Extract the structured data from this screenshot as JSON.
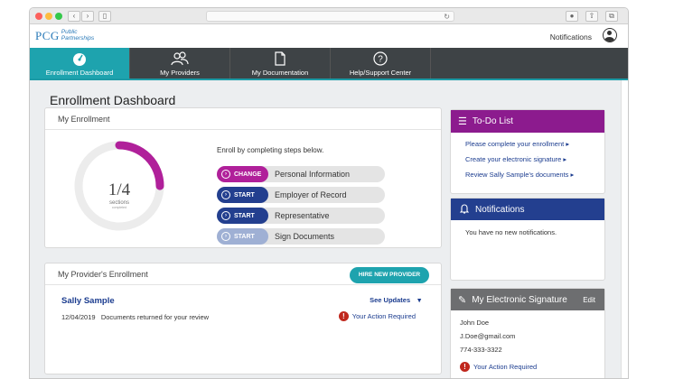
{
  "header": {
    "logo_mark": "PCG",
    "logo_line1": "Public",
    "logo_line2": "Partnerships",
    "notifications_link": "Notifications"
  },
  "nav": {
    "tabs": [
      {
        "label": "Enrollment Dashboard",
        "icon": "gauge-icon"
      },
      {
        "label": "My Providers",
        "icon": "people-icon"
      },
      {
        "label": "My Documentation",
        "icon": "document-icon"
      },
      {
        "label": "Help/Support Center",
        "icon": "help-icon"
      }
    ]
  },
  "page": {
    "title": "Enrollment Dashboard"
  },
  "enrollment": {
    "title": "My Enrollment",
    "progress_text": "1/4",
    "progress_fraction": 0.25,
    "progress_label": "sections",
    "progress_sub": "completed",
    "intro": "Enroll by completing steps below.",
    "steps": [
      {
        "action": "CHANGE",
        "label": "Personal Information",
        "color": "#b0209a"
      },
      {
        "action": "START",
        "label": "Employer of Record",
        "color": "#233f8f"
      },
      {
        "action": "START",
        "label": "Representative",
        "color": "#233f8f"
      },
      {
        "action": "START",
        "label": "Sign Documents",
        "color": "#9fb0d4"
      }
    ]
  },
  "providers": {
    "title": "My Provider's Enrollment",
    "hire_button": "HIRE NEW PROVIDER",
    "name": "Sally Sample",
    "see_updates": "See Updates",
    "date": "12/04/2019",
    "message": "Documents returned for your review",
    "action": "Your Action Required"
  },
  "todo": {
    "title": "To-Do List",
    "items": [
      "Please complete your enrollment",
      "Create your electronic signature",
      "Review Sally Sample's documents"
    ]
  },
  "notifications": {
    "title": "Notifications",
    "empty": "You have no new notifications."
  },
  "signature": {
    "title": "My Electronic Signature",
    "edit": "Edit",
    "name": "John Doe",
    "email": "J.Doe@gmail.com",
    "phone": "774-333-3322",
    "action": "Your Action Required"
  },
  "colors": {
    "accent": "#1ea3ae",
    "todo": "#8c1b8e",
    "notifications": "#233f8f",
    "signature": "#6d6e70",
    "alert": "#c0271d"
  }
}
